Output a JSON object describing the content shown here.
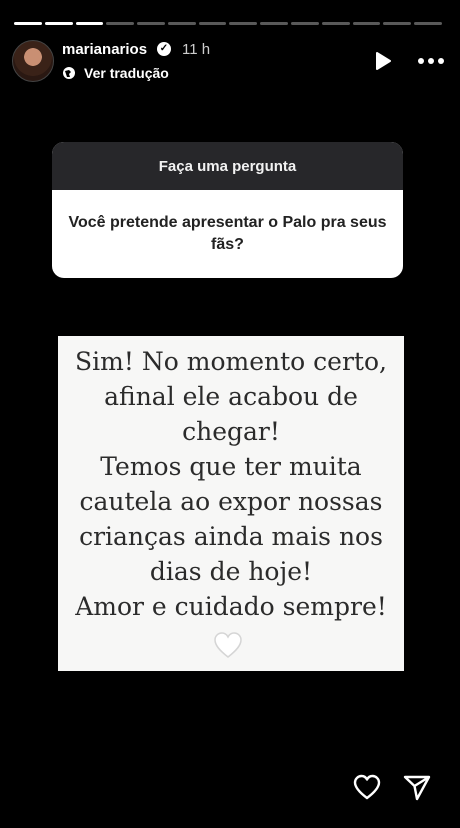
{
  "story": {
    "segments_total": 14,
    "segments_viewed": 3
  },
  "header": {
    "username": "marianarios",
    "time": "11 h",
    "translate_label": "Ver tradução",
    "verified_mark": "✓"
  },
  "question_sticker": {
    "title": "Faça uma pergunta",
    "question": "Você pretende apresentar o Palo pra seus fãs?"
  },
  "answer": {
    "text": "Sim! No momento certo,\nafinal ele acabou de\nchegar!\nTemos que ter muita\ncautela ao expor nossas\ncrianças ainda mais nos\ndias de hoje!\nAmor e cuidado sempre!"
  },
  "icons": {
    "avatar": "profile-photo",
    "verified": "verified-badge-icon",
    "translate": "globe-icon",
    "play": "play-icon",
    "more": "more-options-icon",
    "heart_emoji": "white-heart-icon",
    "like": "heart-outline-icon",
    "send": "paper-plane-icon"
  }
}
